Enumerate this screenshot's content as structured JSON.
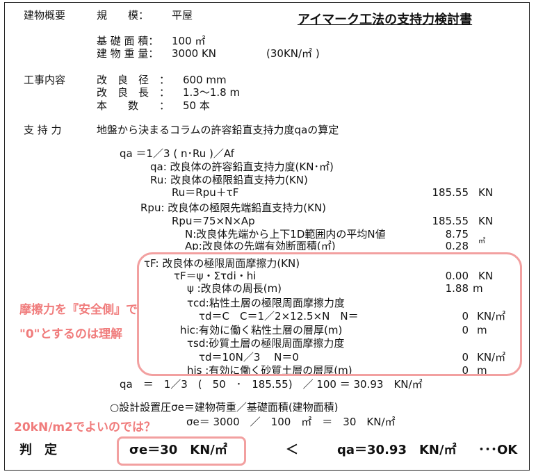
{
  "title": "アイマーク工法の支持力検討書",
  "overview": {
    "heading": "建物概要",
    "scale_label": "規　　模：",
    "scale_value": "平屋",
    "area_label": "基 礎 面 積：",
    "area_value": "100 ㎡",
    "weight_label": "建 物 重 量：",
    "weight_value": "3000 KN",
    "weight_note": "(30KN/㎡ )"
  },
  "work": {
    "heading": "工事内容",
    "diameter_label": "改　良　径　：",
    "diameter_value": "600 mm",
    "length_label": "改　良　長　：",
    "length_value": "1.3〜1.8 m",
    "count_label": "本　　数　　：",
    "count_value": "50 本"
  },
  "bearing": {
    "heading": "支 持 力",
    "description": "地盤から決まるコラムの許容鉛直支持力度qaの算定",
    "formula": "qa ＝1／3 ( n･Ru )／Af",
    "lines": [
      {
        "text": "qa: 改良体の許容鉛直支持力度(KN･㎡)",
        "value": "",
        "unit": ""
      },
      {
        "text": "Ru: 改良体の極限鉛直支持力(KN)",
        "value": "",
        "unit": ""
      },
      {
        "text": "Ru＝Rpu＋τF",
        "value": "185.55",
        "unit": "KN"
      },
      {
        "text": "Rpu: 改良体の極限先端鉛直支持力(KN)",
        "value": "",
        "unit": ""
      },
      {
        "text": "Rpu＝75×N×Ap",
        "value": "185.55",
        "unit": "KN"
      },
      {
        "text": "N:改良体先端から上下1D範囲内の平均N値",
        "value": "8.75",
        "unit": ""
      },
      {
        "text": "Ap:改良体の先端有効断面積(㎡)",
        "value": "0.28",
        "unit": "㎡"
      },
      {
        "text": "τF: 改良体の極限周面摩擦力(KN)",
        "value": "",
        "unit": ""
      },
      {
        "text": "τF＝ψ・Στdi・hi",
        "value": "0.00",
        "unit": "KN"
      },
      {
        "text": "ψ :改良体の周長(m)",
        "value": "1.88",
        "unit": "m"
      },
      {
        "text": "τcd:粘性土層の極限周面摩擦力度",
        "value": "",
        "unit": ""
      },
      {
        "text": "τd＝C　C＝1／2×12.5×N　N＝",
        "value": "0",
        "unit": "KN/㎡"
      },
      {
        "text": "hic:有効に働く粘性土層の層厚(m)",
        "value": "0",
        "unit": "m"
      },
      {
        "text": "τsd:砂質土層の極限周面摩擦力度",
        "value": "",
        "unit": ""
      },
      {
        "text": "τd＝10N／3　 N＝0",
        "value": "0",
        "unit": "KN/㎡"
      },
      {
        "text": "his :有効に働く砂質土層の層厚(m)",
        "value": "0",
        "unit": "m"
      }
    ],
    "qa_result": "qa　＝　1／3　(　50　･　185.55)　／ 100 ＝ 30.93　KN/㎡"
  },
  "design": {
    "heading": "○設計設置圧σe＝建物荷重／基礎面積(建物面積)",
    "calc": "σe＝ 3000　／　100　㎡　＝　30　KN/㎡"
  },
  "verdict": {
    "label": "判　定",
    "sigma": "σe＝30　KN/㎡",
    "less_than": "＜",
    "qa": "qa＝30.93　KN/㎡",
    "ok": "･･･OK"
  },
  "annotations": {
    "friction_line1": "摩擦力を『安全側』で",
    "friction_line2": "\"0\"とするのは理解",
    "design_question": "20kN/m2でよいのでは？"
  },
  "colors": {
    "annotation": "#f07c7c",
    "annotation_box": "#f2a0a0"
  }
}
